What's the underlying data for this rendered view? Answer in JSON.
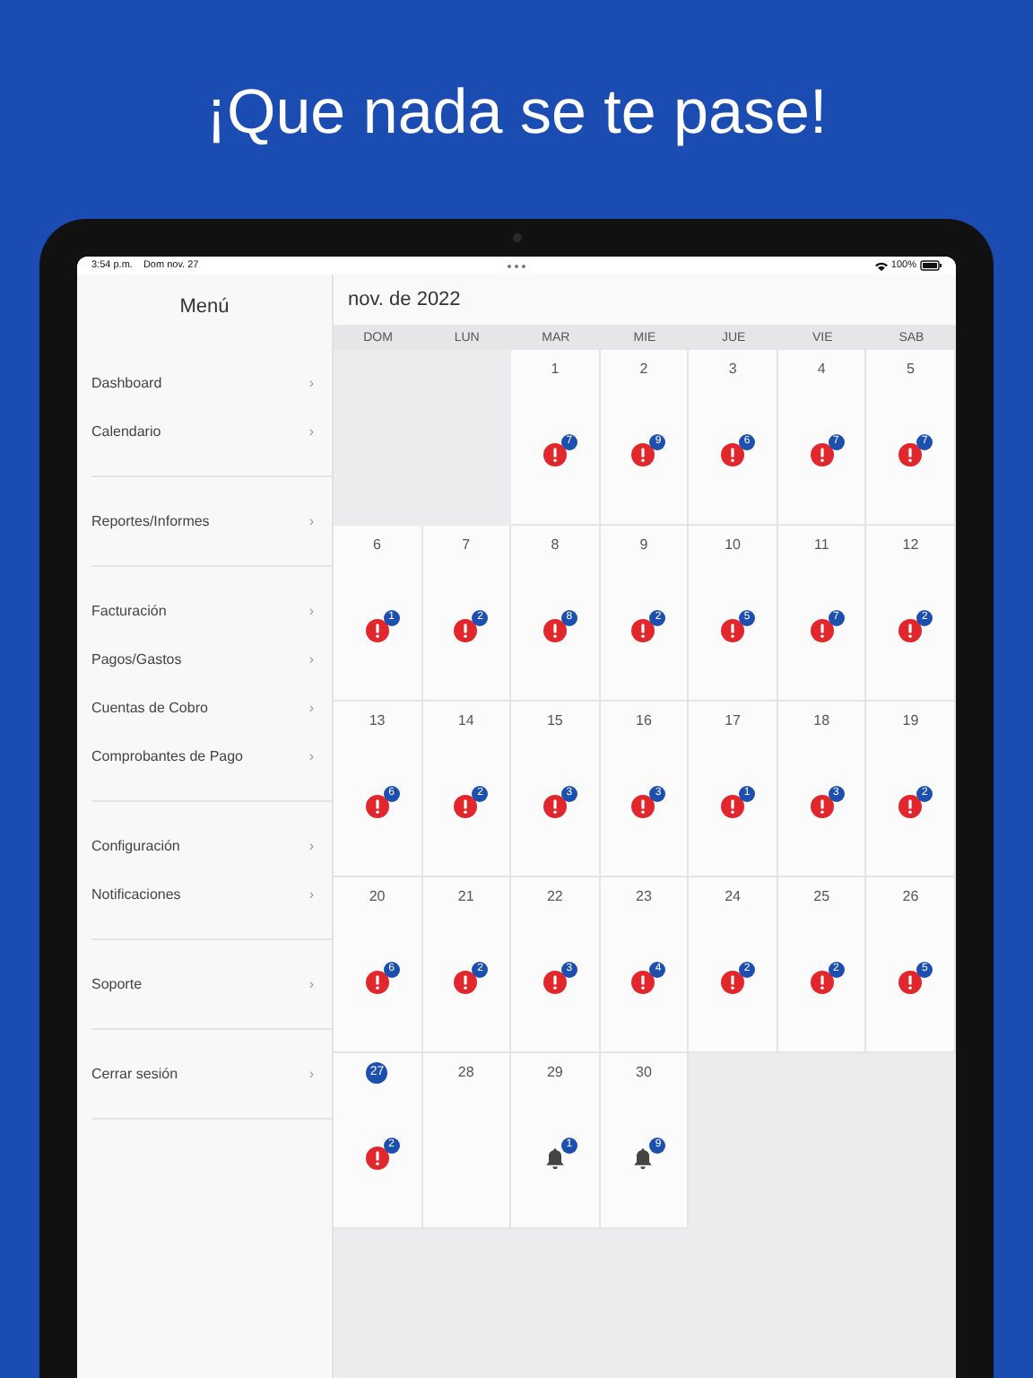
{
  "headline": "¡Que nada se te pase!",
  "status_bar": {
    "time": "3:54 p.m.",
    "date": "Dom nov. 27",
    "battery": "100%"
  },
  "sidebar": {
    "title": "Menú",
    "groups": [
      {
        "items": [
          {
            "label": "Dashboard",
            "chevron": "›"
          },
          {
            "label": "Calendario",
            "chevron": "›"
          }
        ]
      },
      {
        "items": [
          {
            "label": "Reportes/Informes",
            "chevron": "›"
          }
        ]
      },
      {
        "items": [
          {
            "label": "Facturación",
            "chevron": "›"
          },
          {
            "label": "Pagos/Gastos",
            "chevron": "›"
          },
          {
            "label": "Cuentas de Cobro",
            "chevron": "›"
          },
          {
            "label": "Comprobantes de Pago",
            "chevron": "›"
          }
        ]
      },
      {
        "items": [
          {
            "label": "Configuración",
            "chevron": "›"
          },
          {
            "label": "Notificaciones",
            "chevron": "›"
          }
        ]
      },
      {
        "items": [
          {
            "label": "Soporte",
            "chevron": "›"
          }
        ]
      },
      {
        "items": [
          {
            "label": "Cerrar sesión",
            "chevron": "›"
          }
        ]
      }
    ]
  },
  "calendar": {
    "month": "nov. de 2022",
    "weekdays": [
      "DOM",
      "LUN",
      "MAR",
      "MIE",
      "JUE",
      "VIE",
      "SAB"
    ],
    "weeks": [
      [
        {
          "kind": "empty"
        },
        {
          "kind": "empty"
        },
        {
          "kind": "alert",
          "day": "1",
          "count": "7",
          "today": false
        },
        {
          "kind": "alert",
          "day": "2",
          "count": "9",
          "today": false
        },
        {
          "kind": "alert",
          "day": "3",
          "count": "6",
          "today": false
        },
        {
          "kind": "alert",
          "day": "4",
          "count": "7",
          "today": false
        },
        {
          "kind": "alert",
          "day": "5",
          "count": "7",
          "today": false
        }
      ],
      [
        {
          "kind": "alert",
          "day": "6",
          "count": "1",
          "today": false
        },
        {
          "kind": "alert",
          "day": "7",
          "count": "2",
          "today": false
        },
        {
          "kind": "alert",
          "day": "8",
          "count": "8",
          "today": false
        },
        {
          "kind": "alert",
          "day": "9",
          "count": "2",
          "today": false
        },
        {
          "kind": "alert",
          "day": "10",
          "count": "5",
          "today": false
        },
        {
          "kind": "alert",
          "day": "11",
          "count": "7",
          "today": false
        },
        {
          "kind": "alert",
          "day": "12",
          "count": "2",
          "today": false
        }
      ],
      [
        {
          "kind": "alert",
          "day": "13",
          "count": "6",
          "today": false
        },
        {
          "kind": "alert",
          "day": "14",
          "count": "2",
          "today": false
        },
        {
          "kind": "alert",
          "day": "15",
          "count": "3",
          "today": false
        },
        {
          "kind": "alert",
          "day": "16",
          "count": "3",
          "today": false
        },
        {
          "kind": "alert",
          "day": "17",
          "count": "1",
          "today": false
        },
        {
          "kind": "alert",
          "day": "18",
          "count": "3",
          "today": false
        },
        {
          "kind": "alert",
          "day": "19",
          "count": "2",
          "today": false
        }
      ],
      [
        {
          "kind": "alert",
          "day": "20",
          "count": "6",
          "today": false
        },
        {
          "kind": "alert",
          "day": "21",
          "count": "2",
          "today": false
        },
        {
          "kind": "alert",
          "day": "22",
          "count": "3",
          "today": false
        },
        {
          "kind": "alert",
          "day": "23",
          "count": "4",
          "today": false
        },
        {
          "kind": "alert",
          "day": "24",
          "count": "2",
          "today": false
        },
        {
          "kind": "alert",
          "day": "25",
          "count": "2",
          "today": false
        },
        {
          "kind": "alert",
          "day": "26",
          "count": "5",
          "today": false
        }
      ],
      [
        {
          "kind": "alert",
          "day": "27",
          "count": "2",
          "today": true
        },
        {
          "kind": "plain",
          "day": "28",
          "today": false
        },
        {
          "kind": "bell",
          "day": "29",
          "count": "1",
          "today": false
        },
        {
          "kind": "bell",
          "day": "30",
          "count": "9",
          "today": false
        },
        {
          "kind": "empty"
        },
        {
          "kind": "empty"
        },
        {
          "kind": "empty"
        }
      ]
    ]
  }
}
